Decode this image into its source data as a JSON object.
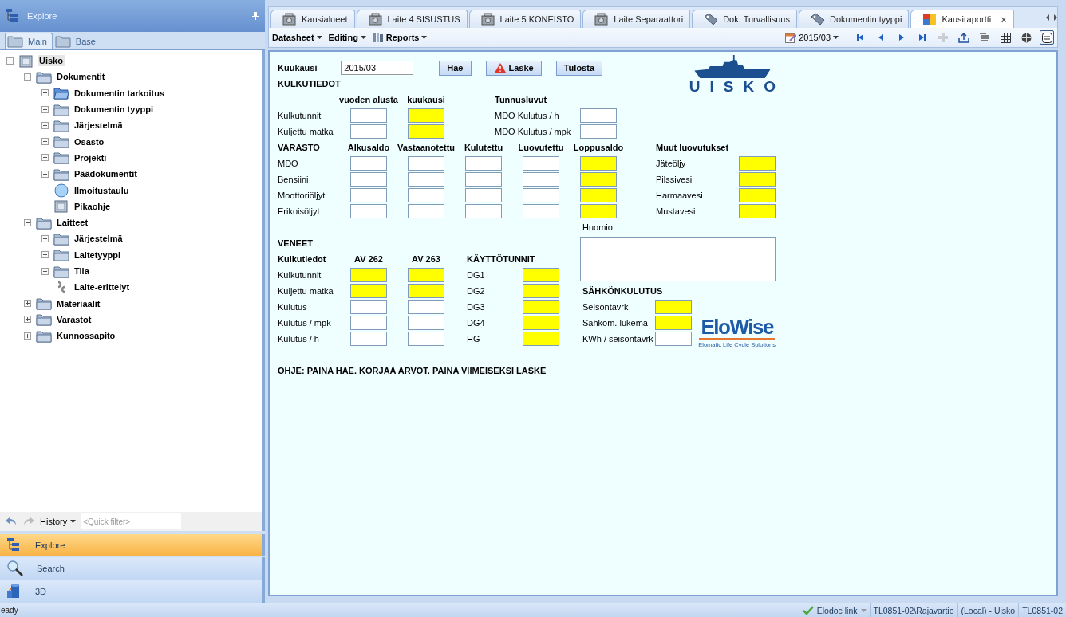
{
  "explorer": {
    "title": "Explore",
    "tabs": [
      {
        "label": "Main",
        "selected": true
      },
      {
        "label": "Base",
        "selected": false
      }
    ],
    "tree": [
      {
        "label": "Uisko",
        "kind": "document",
        "expanded": true,
        "selected": true,
        "children": [
          {
            "label": "Dokumentit",
            "kind": "folder",
            "expanded": true,
            "selected": false,
            "children": [
              {
                "label": "Dokumentin tarkoitus",
                "kind": "open-folder",
                "expanded": false,
                "selected": false
              },
              {
                "label": "Dokumentin tyyppi",
                "kind": "folder",
                "expanded": false,
                "selected": false
              },
              {
                "label": "Järjestelmä",
                "kind": "folder",
                "expanded": false,
                "selected": false
              },
              {
                "label": "Osasto",
                "kind": "folder",
                "expanded": false,
                "selected": false
              },
              {
                "label": "Projekti",
                "kind": "folder",
                "expanded": false,
                "selected": false
              },
              {
                "label": "Päädokumentit",
                "kind": "folder",
                "expanded": false,
                "selected": false
              },
              {
                "label": "Ilmoitustaulu",
                "kind": "sphere",
                "selected": false
              },
              {
                "label": "Pikaohje",
                "kind": "document",
                "selected": false
              }
            ]
          },
          {
            "label": "Laitteet",
            "kind": "folder",
            "expanded": true,
            "selected": false,
            "children": [
              {
                "label": "Järjestelmä",
                "kind": "folder",
                "expanded": false,
                "selected": false
              },
              {
                "label": "Laitetyyppi",
                "kind": "folder",
                "expanded": false,
                "selected": false
              },
              {
                "label": "Tila",
                "kind": "folder",
                "expanded": false,
                "selected": false
              },
              {
                "label": "Laite-erittelyt",
                "kind": "link",
                "selected": false
              }
            ]
          },
          {
            "label": "Materiaalit",
            "kind": "folder",
            "expanded": false,
            "selected": false
          },
          {
            "label": "Varastot",
            "kind": "folder",
            "expanded": false,
            "selected": false
          },
          {
            "label": "Kunnossapito",
            "kind": "folder",
            "expanded": false,
            "selected": false
          }
        ]
      }
    ],
    "history": {
      "label": "History",
      "filter_placeholder": "<Quick filter>"
    },
    "nav": [
      {
        "label": "Explore",
        "kind": "explore",
        "selected": true
      },
      {
        "label": "Search",
        "kind": "search",
        "selected": false
      },
      {
        "label": "3D",
        "kind": "model",
        "selected": false
      }
    ]
  },
  "doc_tabs": [
    {
      "label": "Kansialueet",
      "kind": "machine",
      "selected": false
    },
    {
      "label": "Laite 4 SISUSTUS",
      "kind": "machine",
      "selected": false
    },
    {
      "label": "Laite 5 KONEISTO",
      "kind": "machine",
      "selected": false
    },
    {
      "label": "Laite Separaattori",
      "kind": "machine",
      "selected": false
    },
    {
      "label": "Dok. Turvallisuus",
      "kind": "tag",
      "selected": false
    },
    {
      "label": "Dokumentin tyyppi",
      "kind": "tag",
      "selected": false
    },
    {
      "label": "Kausiraportti",
      "kind": "report",
      "selected": true,
      "close": "×"
    }
  ],
  "toolbar": {
    "menus": [
      {
        "label": "Datasheet",
        "kind": "plain"
      },
      {
        "label": "Editing",
        "kind": "plain"
      },
      {
        "label": "Reports",
        "kind": "reports"
      }
    ],
    "period": "2015/03",
    "tools": [
      {
        "kind": "first",
        "disabled": false,
        "selected": false
      },
      {
        "kind": "prev",
        "disabled": false,
        "selected": false
      },
      {
        "kind": "next",
        "disabled": false,
        "selected": false
      },
      {
        "kind": "last",
        "disabled": false,
        "selected": false
      },
      {
        "kind": "add",
        "disabled": true,
        "selected": false
      },
      {
        "kind": "export",
        "disabled": false,
        "selected": false
      },
      {
        "kind": "properties",
        "disabled": false,
        "selected": false
      },
      {
        "kind": "grid",
        "disabled": false,
        "selected": false
      },
      {
        "kind": "globe",
        "disabled": false,
        "selected": false
      },
      {
        "kind": "form",
        "disabled": false,
        "selected": true
      }
    ]
  },
  "form": {
    "month": {
      "label": "Kuukausi",
      "value": "2015/03"
    },
    "buttons": [
      {
        "label": "Hae",
        "kind": "plain"
      },
      {
        "label": "Laske",
        "kind": "warning"
      },
      {
        "label": "Tulosta",
        "kind": "plain"
      }
    ],
    "logo": "UISKO",
    "travel": {
      "title": "KULKUTIEDOT",
      "columns": [
        "vuoden alusta",
        "kuukausi"
      ],
      "rows": [
        {
          "label": "Kulkutunnit",
          "fields": [
            {
              "highlighted": false
            },
            {
              "highlighted": true
            }
          ]
        },
        {
          "label": "Kuljettu matka",
          "fields": [
            {
              "highlighted": false
            },
            {
              "highlighted": true
            }
          ]
        }
      ]
    },
    "ratios": {
      "title": "Tunnusluvut",
      "rows": [
        {
          "label": "MDO Kulutus / h",
          "highlighted": false
        },
        {
          "label": "MDO Kulutus / mpk",
          "highlighted": false
        }
      ]
    },
    "stock": {
      "title": "VARASTO",
      "columns": [
        "Alkusaldo",
        "Vastaanotettu",
        "Kulutettu",
        "Luovutettu",
        "Loppusaldo"
      ],
      "rows": [
        {
          "label": "MDO",
          "fields": [
            {
              "highlighted": false
            },
            {
              "highlighted": false
            },
            {
              "highlighted": false
            },
            {
              "highlighted": false
            },
            {
              "highlighted": true
            }
          ]
        },
        {
          "label": "Bensiini",
          "fields": [
            {
              "highlighted": false
            },
            {
              "highlighted": false
            },
            {
              "highlighted": false
            },
            {
              "highlighted": false
            },
            {
              "highlighted": true
            }
          ]
        },
        {
          "label": "Moottoriöljyt",
          "fields": [
            {
              "highlighted": false
            },
            {
              "highlighted": false
            },
            {
              "highlighted": false
            },
            {
              "highlighted": false
            },
            {
              "highlighted": true
            }
          ]
        },
        {
          "label": "Erikoisöljyt",
          "fields": [
            {
              "highlighted": false
            },
            {
              "highlighted": false
            },
            {
              "highlighted": false
            },
            {
              "highlighted": false
            },
            {
              "highlighted": true
            }
          ]
        }
      ]
    },
    "other": {
      "title": "Muut luovutukset",
      "rows": [
        {
          "label": "Jäteöljy",
          "highlighted": true
        },
        {
          "label": "Pilssivesi",
          "highlighted": true
        },
        {
          "label": "Harmaavesi",
          "highlighted": true
        },
        {
          "label": "Mustavesi",
          "highlighted": true
        }
      ]
    },
    "note": {
      "label": "Huomio"
    },
    "boats": {
      "title": "VENEET",
      "header": "Kulkutiedot",
      "columns": [
        "AV 262",
        "AV 263"
      ],
      "rows": [
        {
          "label": "Kulkutunnit",
          "fields": [
            {
              "highlighted": true
            },
            {
              "highlighted": true
            }
          ]
        },
        {
          "label": "Kuljettu matka",
          "fields": [
            {
              "highlighted": true
            },
            {
              "highlighted": true
            }
          ]
        },
        {
          "label": "Kulutus",
          "fields": [
            {
              "highlighted": false
            },
            {
              "highlighted": false
            }
          ]
        },
        {
          "label": "Kulutus / mpk",
          "fields": [
            {
              "highlighted": false
            },
            {
              "highlighted": false
            }
          ]
        },
        {
          "label": "Kulutus / h",
          "fields": [
            {
              "highlighted": false
            },
            {
              "highlighted": false
            }
          ]
        }
      ]
    },
    "hours": {
      "title": "KÄYTTÖTUNNIT",
      "rows": [
        {
          "label": "DG1",
          "highlighted": true
        },
        {
          "label": "DG2",
          "highlighted": true
        },
        {
          "label": "DG3",
          "highlighted": true
        },
        {
          "label": "DG4",
          "highlighted": true
        },
        {
          "label": "HG",
          "highlighted": true
        }
      ]
    },
    "power": {
      "title": "SÄHKÖNKULUTUS",
      "rows": [
        {
          "label": "Seisontavrk",
          "highlighted": true
        },
        {
          "label": "Sähköm. lukema",
          "highlighted": true
        },
        {
          "label": "KWh / seisontavrk",
          "highlighted": false
        }
      ],
      "logo": {
        "name": "EloWise",
        "tagline": "Elomatic Life Cycle Solutions"
      }
    },
    "hint": "OHJE: PAINA HAE. KORJAA ARVOT. PAINA VIIMEISEKSI LASKE"
  },
  "status_bar": {
    "text": "eady",
    "items": [
      {
        "label": "Elodoc link",
        "kind": "link"
      },
      {
        "label": "TL0851-02\\Rajavartio",
        "kind": "plain"
      },
      {
        "label": "(Local) - Uisko",
        "kind": "plain"
      },
      {
        "label": "TL0851-02",
        "kind": "plain"
      }
    ]
  }
}
